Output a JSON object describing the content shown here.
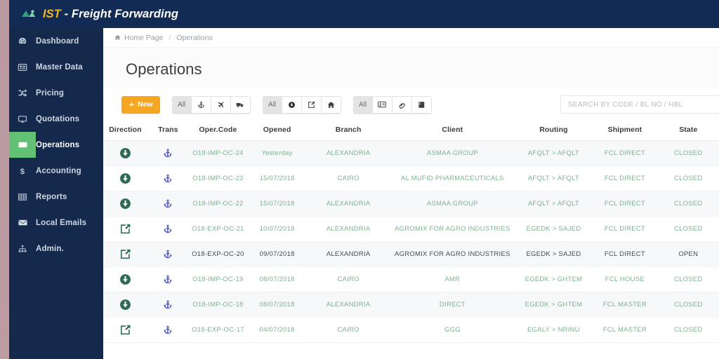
{
  "brand": {
    "logo_icon": "mountain-logo-icon",
    "name": "IST",
    "suffix": " - Freight Forwarding"
  },
  "sidebar": {
    "items": [
      {
        "label": "Dashboard",
        "icon": "dashboard-icon",
        "active": false
      },
      {
        "label": "Master Data",
        "icon": "database-icon",
        "active": false
      },
      {
        "label": "Pricing",
        "icon": "shuffle-icon",
        "active": false
      },
      {
        "label": "Quotations",
        "icon": "monitor-icon",
        "active": false
      },
      {
        "label": "Operations",
        "icon": "operations-icon",
        "active": true
      },
      {
        "label": "Accounting",
        "icon": "dollar-icon",
        "active": false
      },
      {
        "label": "Reports",
        "icon": "table-icon",
        "active": false
      },
      {
        "label": "Local Emails",
        "icon": "envelope-icon",
        "active": false
      },
      {
        "label": "Admin.",
        "icon": "sitemap-icon",
        "active": false
      }
    ]
  },
  "breadcrumb": {
    "home_icon": "home-icon",
    "home": "Home Page",
    "separator": "/",
    "current": "Operations"
  },
  "page": {
    "title": "Operations"
  },
  "toolbar": {
    "new_label": "New",
    "new_icon": "plus-icon",
    "groups": [
      {
        "name": "transport-mode-filter",
        "buttons": [
          {
            "label": "All",
            "icon": null,
            "selected": true
          },
          {
            "label": "",
            "icon": "anchor-icon",
            "selected": false
          },
          {
            "label": "",
            "icon": "plane-icon",
            "selected": false
          },
          {
            "label": "",
            "icon": "truck-icon",
            "selected": false
          }
        ]
      },
      {
        "name": "direction-filter",
        "buttons": [
          {
            "label": "All",
            "icon": null,
            "selected": true
          },
          {
            "label": "",
            "icon": "import-circle-icon",
            "selected": false
          },
          {
            "label": "",
            "icon": "export-arrow-icon",
            "selected": false
          },
          {
            "label": "",
            "icon": "home-solid-icon",
            "selected": false
          }
        ]
      },
      {
        "name": "document-filter",
        "buttons": [
          {
            "label": "All",
            "icon": null,
            "selected": true
          },
          {
            "label": "",
            "icon": "id-card-icon",
            "selected": false
          },
          {
            "label": "",
            "icon": "paperclip-icon",
            "selected": false
          },
          {
            "label": "",
            "icon": "book-icon",
            "selected": false
          }
        ]
      }
    ]
  },
  "search": {
    "placeholder": "SEARCH BY CODE / BL NO / HBL",
    "value": ""
  },
  "table": {
    "columns": [
      "Direction",
      "Trans",
      "Oper.Code",
      "Opened",
      "Branch",
      "Client",
      "Routing",
      "Shipment",
      "State"
    ],
    "rows": [
      {
        "direction_icon": "import-down-icon",
        "trans_icon": "anchor-icon",
        "code": "O18-IMP-OC-24",
        "opened": "Yesterday",
        "branch": "ALEXANDRIA",
        "client": "ASMAA GROUP",
        "routing": "AFQLT > AFQLT",
        "shipment": "FCL DIRECT",
        "state": "CLOSED",
        "highlighted": false
      },
      {
        "direction_icon": "import-down-icon",
        "trans_icon": "anchor-icon",
        "code": "O18-IMP-OC-23",
        "opened": "15/07/2018",
        "branch": "CAIRO",
        "client": "AL MUFID PHARMACEUTICALS",
        "routing": "AFQLT > AFQLT",
        "shipment": "FCL DIRECT",
        "state": "CLOSED",
        "highlighted": false
      },
      {
        "direction_icon": "import-down-icon",
        "trans_icon": "anchor-icon",
        "code": "O18-IMP-OC-22",
        "opened": "15/07/2018",
        "branch": "ALEXANDRIA",
        "client": "ASMAA GROUP",
        "routing": "AFQLT > AFQLT",
        "shipment": "FCL DIRECT",
        "state": "CLOSED",
        "highlighted": false
      },
      {
        "direction_icon": "export-out-icon",
        "trans_icon": "anchor-icon",
        "code": "O18-EXP-OC-21",
        "opened": "10/07/2018",
        "branch": "ALEXANDRIA",
        "client": "AGROMIX FOR AGRO INDUSTRIES",
        "routing": "EGEDK > SAJED",
        "shipment": "FCL DIRECT",
        "state": "CLOSED",
        "highlighted": false
      },
      {
        "direction_icon": "export-out-icon",
        "trans_icon": "anchor-icon",
        "code": "O18-EXP-OC-20",
        "opened": "09/07/2018",
        "branch": "ALEXANDRIA",
        "client": "AGROMIX FOR AGRO INDUSTRIES",
        "routing": "EGEDK > SAJED",
        "shipment": "FCL DIRECT",
        "state": "OPEN",
        "highlighted": true
      },
      {
        "direction_icon": "import-down-icon",
        "trans_icon": "anchor-icon",
        "code": "O18-IMP-OC-19",
        "opened": "08/07/2018",
        "branch": "CAIRO",
        "client": "AMR",
        "routing": "EGEDK > GHTEM",
        "shipment": "FCL HOUSE",
        "state": "CLOSED",
        "highlighted": false
      },
      {
        "direction_icon": "import-down-icon",
        "trans_icon": "anchor-icon",
        "code": "O18-IMP-OC-18",
        "opened": "08/07/2018",
        "branch": "ALEXANDRIA",
        "client": "DIRECT",
        "routing": "EGEDK > GHTEM",
        "shipment": "FCL MASTER",
        "state": "CLOSED",
        "highlighted": false
      },
      {
        "direction_icon": "export-out-icon",
        "trans_icon": "anchor-icon",
        "code": "O18-EXP-OC-17",
        "opened": "04/07/2018",
        "branch": "CAIRO",
        "client": "GGG",
        "routing": "EGALY > NRINU",
        "shipment": "FCL MASTER",
        "state": "CLOSED",
        "highlighted": false
      }
    ]
  },
  "colors": {
    "topbar": "#122b54",
    "sidebar": "#14294b",
    "active_green": "#63c176",
    "brand_yellow": "#f0b429",
    "new_orange": "#f5a623",
    "row_text_green": "#7fb291",
    "direction_green": "#2f6b52",
    "anchor_blue": "#4e56c8"
  }
}
